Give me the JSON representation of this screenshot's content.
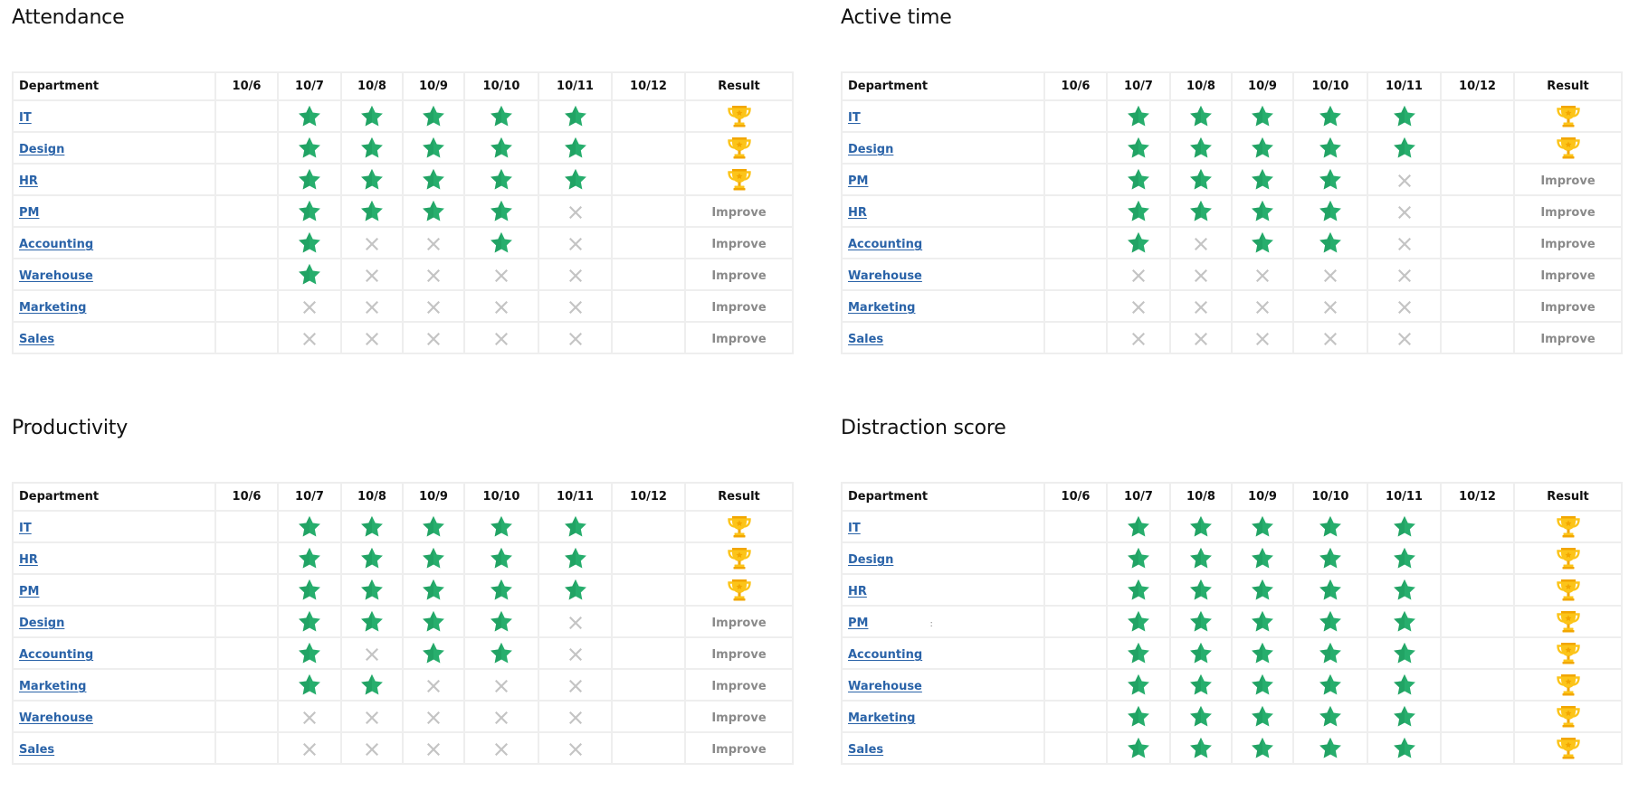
{
  "columns": {
    "department": "Department",
    "dates": [
      "10/6",
      "10/7",
      "10/8",
      "10/9",
      "10/10",
      "10/11",
      "10/12"
    ],
    "result": "Result"
  },
  "legend": {
    "star": "green-star-icon (goal met)",
    "cross": "gray-cross-icon (goal missed)",
    "trophy": "gold-trophy-icon (all goals met)",
    "improve_label": "Improve"
  },
  "colors": {
    "star": "#27ae6d",
    "star_shade": "#1e9a5c",
    "cross": "#c4c4c4",
    "trophy": "#fcc419",
    "trophy_shade": "#f2a600",
    "link": "#2a63a8",
    "improve": "#8a8a8a",
    "grid_line": "#eeeeee"
  },
  "panels": [
    {
      "title": "Attendance",
      "rows": [
        {
          "department": "IT",
          "marks": [
            "",
            "star",
            "star",
            "star",
            "star",
            "star",
            ""
          ],
          "result": "trophy"
        },
        {
          "department": "Design",
          "marks": [
            "",
            "star",
            "star",
            "star",
            "star",
            "star",
            ""
          ],
          "result": "trophy"
        },
        {
          "department": "HR",
          "marks": [
            "",
            "star",
            "star",
            "star",
            "star",
            "star",
            ""
          ],
          "result": "trophy"
        },
        {
          "department": "PM",
          "marks": [
            "",
            "star",
            "star",
            "star",
            "star",
            "cross",
            ""
          ],
          "result": "Improve"
        },
        {
          "department": "Accounting",
          "marks": [
            "",
            "star",
            "cross",
            "cross",
            "star",
            "cross",
            ""
          ],
          "result": "Improve"
        },
        {
          "department": "Warehouse",
          "marks": [
            "",
            "star",
            "cross",
            "cross",
            "cross",
            "cross",
            ""
          ],
          "result": "Improve"
        },
        {
          "department": "Marketing",
          "marks": [
            "",
            "cross",
            "cross",
            "cross",
            "cross",
            "cross",
            ""
          ],
          "result": "Improve"
        },
        {
          "department": "Sales",
          "marks": [
            "",
            "cross",
            "cross",
            "cross",
            "cross",
            "cross",
            ""
          ],
          "result": "Improve"
        }
      ]
    },
    {
      "title": "Active time",
      "rows": [
        {
          "department": "IT",
          "marks": [
            "",
            "star",
            "star",
            "star",
            "star",
            "star",
            ""
          ],
          "result": "trophy"
        },
        {
          "department": "Design",
          "marks": [
            "",
            "star",
            "star",
            "star",
            "star",
            "star",
            ""
          ],
          "result": "trophy"
        },
        {
          "department": "PM",
          "marks": [
            "",
            "star",
            "star",
            "star",
            "star",
            "cross",
            ""
          ],
          "result": "Improve"
        },
        {
          "department": "HR",
          "marks": [
            "",
            "star",
            "star",
            "star",
            "star",
            "cross",
            ""
          ],
          "result": "Improve"
        },
        {
          "department": "Accounting",
          "marks": [
            "",
            "star",
            "cross",
            "star",
            "star",
            "cross",
            ""
          ],
          "result": "Improve"
        },
        {
          "department": "Warehouse",
          "marks": [
            "",
            "cross",
            "cross",
            "cross",
            "cross",
            "cross",
            ""
          ],
          "result": "Improve"
        },
        {
          "department": "Marketing",
          "marks": [
            "",
            "cross",
            "cross",
            "cross",
            "cross",
            "cross",
            ""
          ],
          "result": "Improve"
        },
        {
          "department": "Sales",
          "marks": [
            "",
            "cross",
            "cross",
            "cross",
            "cross",
            "cross",
            ""
          ],
          "result": "Improve"
        }
      ]
    },
    {
      "title": "Productivity",
      "rows": [
        {
          "department": "IT",
          "marks": [
            "",
            "star",
            "star",
            "star",
            "star",
            "star",
            ""
          ],
          "result": "trophy"
        },
        {
          "department": "HR",
          "marks": [
            "",
            "star",
            "star",
            "star",
            "star",
            "star",
            ""
          ],
          "result": "trophy"
        },
        {
          "department": "PM",
          "marks": [
            "",
            "star",
            "star",
            "star",
            "star",
            "star",
            ""
          ],
          "result": "trophy"
        },
        {
          "department": "Design",
          "marks": [
            "",
            "star",
            "star",
            "star",
            "star",
            "cross",
            ""
          ],
          "result": "Improve"
        },
        {
          "department": "Accounting",
          "marks": [
            "",
            "star",
            "cross",
            "star",
            "star",
            "cross",
            ""
          ],
          "result": "Improve"
        },
        {
          "department": "Marketing",
          "marks": [
            "",
            "star",
            "star",
            "cross",
            "cross",
            "cross",
            ""
          ],
          "result": "Improve"
        },
        {
          "department": "Warehouse",
          "marks": [
            "",
            "cross",
            "cross",
            "cross",
            "cross",
            "cross",
            ""
          ],
          "result": "Improve"
        },
        {
          "department": "Sales",
          "marks": [
            "",
            "cross",
            "cross",
            "cross",
            "cross",
            "cross",
            ""
          ],
          "result": "Improve"
        }
      ]
    },
    {
      "title": "Distraction score",
      "rows": [
        {
          "department": "IT",
          "marks": [
            "",
            "star",
            "star",
            "star",
            "star",
            "star",
            ""
          ],
          "result": "trophy"
        },
        {
          "department": "Design",
          "marks": [
            "",
            "star",
            "star",
            "star",
            "star",
            "star",
            ""
          ],
          "result": "trophy"
        },
        {
          "department": "HR",
          "marks": [
            "",
            "star",
            "star",
            "star",
            "star",
            "star",
            ""
          ],
          "result": "trophy"
        },
        {
          "department": "PM",
          "marks": [
            "",
            "star",
            "star",
            "star",
            "star",
            "star",
            ""
          ],
          "result": "trophy",
          "artifact": ":"
        },
        {
          "department": "Accounting",
          "marks": [
            "",
            "star",
            "star",
            "star",
            "star",
            "star",
            ""
          ],
          "result": "trophy"
        },
        {
          "department": "Warehouse",
          "marks": [
            "",
            "star",
            "star",
            "star",
            "star",
            "star",
            ""
          ],
          "result": "trophy"
        },
        {
          "department": "Marketing",
          "marks": [
            "",
            "star",
            "star",
            "star",
            "star",
            "star",
            ""
          ],
          "result": "trophy"
        },
        {
          "department": "Sales",
          "marks": [
            "",
            "star",
            "star",
            "star",
            "star",
            "star",
            ""
          ],
          "result": "trophy"
        }
      ]
    }
  ]
}
